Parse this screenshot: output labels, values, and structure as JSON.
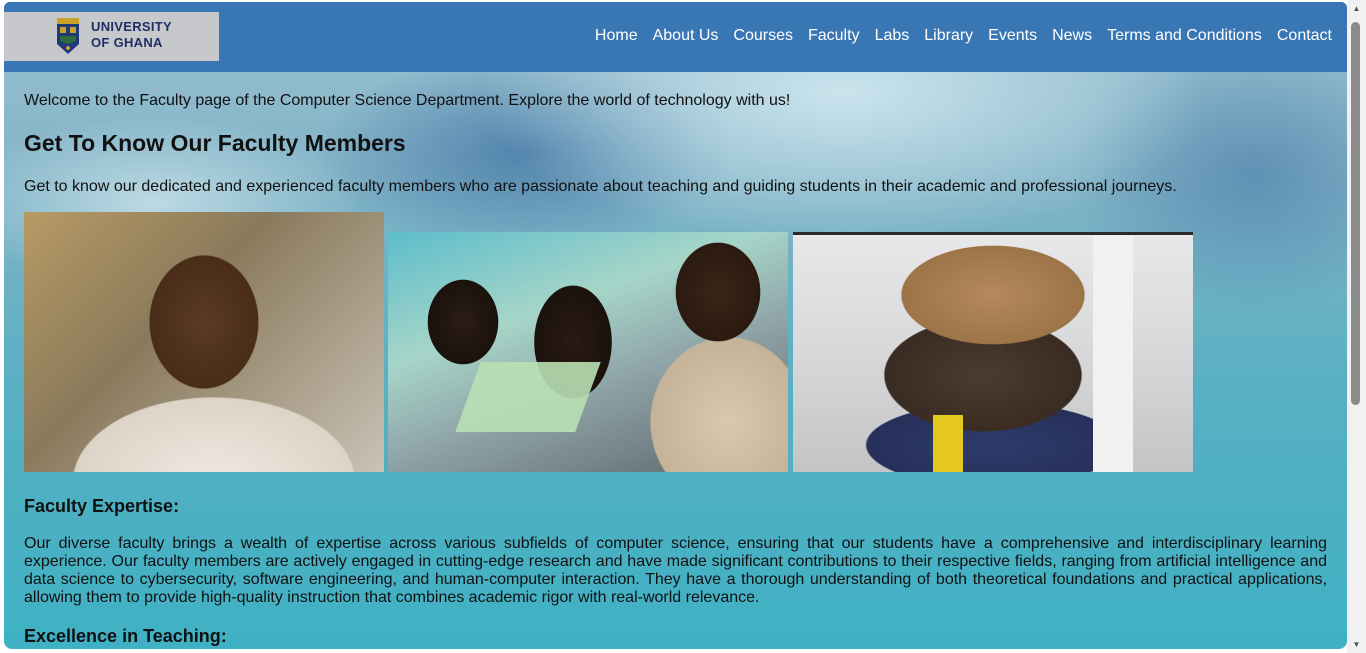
{
  "header": {
    "logo": {
      "line1": "UNIVERSITY",
      "line2": "OF GHANA",
      "icon": "university-crest-icon"
    },
    "nav": [
      {
        "label": "Home"
      },
      {
        "label": "About Us"
      },
      {
        "label": "Courses"
      },
      {
        "label": "Faculty"
      },
      {
        "label": "Labs"
      },
      {
        "label": "Library"
      },
      {
        "label": "Events"
      },
      {
        "label": "News"
      },
      {
        "label": "Terms and Conditions"
      },
      {
        "label": "Contact"
      }
    ]
  },
  "main": {
    "welcome": "Welcome to the Faculty page of the Computer Science Department. Explore the world of technology with us!",
    "title": "Get To Know Our Faculty Members",
    "intro": "Get to know our dedicated and experienced faculty members who are passionate about teaching and guiding students in their academic and professional journeys.",
    "photos": [
      {
        "subject": "faculty-member-portrait"
      },
      {
        "subject": "students-working-on-laptops"
      },
      {
        "subject": "group-photo-with-boxes"
      }
    ],
    "expertise": {
      "heading": "Faculty Expertise:",
      "text": "Our diverse faculty brings a wealth of expertise across various subfields of computer science, ensuring that our students have a comprehensive and interdisciplinary learning experience. Our faculty members are actively engaged in cutting-edge research and have made significant contributions to their respective fields, ranging from artificial intelligence and data science to cybersecurity, software engineering, and human-computer interaction. They have a thorough understanding of both theoretical foundations and practical applications, allowing them to provide high-quality instruction that combines academic rigor with real-world relevance."
    },
    "teaching": {
      "heading": "Excellence in Teaching:"
    }
  },
  "colors": {
    "navbar": "#3876b4",
    "logo_background": "#c7c8cb",
    "logo_text": "#1e2f66",
    "nav_text": "#ffffff"
  }
}
